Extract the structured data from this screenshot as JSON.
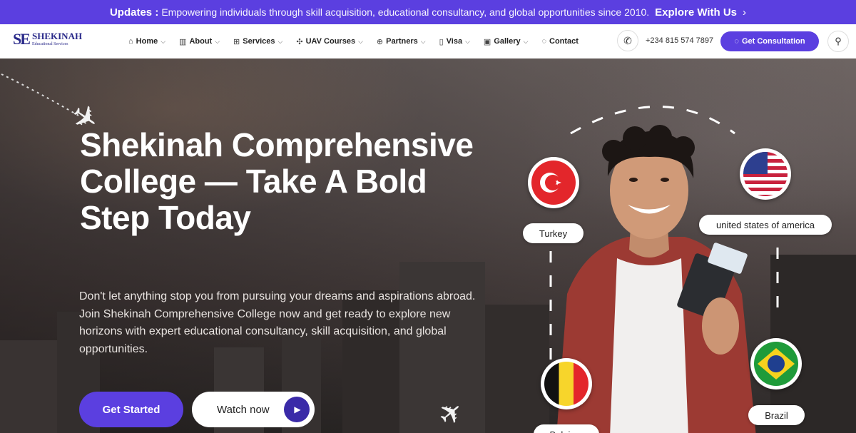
{
  "topbar": {
    "label": "Updates :",
    "message": "Empowering individuals through skill acquisition, educational consultancy, and global opportunities since 2010.",
    "cta": "Explore With Us"
  },
  "logo": {
    "mark": "SE",
    "name": "SHEKINAH",
    "sub": "Educational Services"
  },
  "nav": [
    {
      "label": "Home",
      "icon": "home-icon",
      "dropdown": true
    },
    {
      "label": "About",
      "icon": "chart-icon",
      "dropdown": true
    },
    {
      "label": "Services",
      "icon": "grid-icon",
      "dropdown": true
    },
    {
      "label": "UAV Courses",
      "icon": "drone-icon",
      "dropdown": true
    },
    {
      "label": "Partners",
      "icon": "globe-icon",
      "dropdown": true
    },
    {
      "label": "Visa",
      "icon": "document-icon",
      "dropdown": true
    },
    {
      "label": "Gallery",
      "icon": "image-icon",
      "dropdown": true
    },
    {
      "label": "Contact",
      "icon": "chat-icon",
      "dropdown": false
    }
  ],
  "phone": "+234 815 574 7897",
  "consult_label": "Get Consultation",
  "hero": {
    "title": "Shekinah Comprehensive College — Take A Bold Step Today",
    "description": "Don't let anything stop you from pursuing your dreams and aspirations abroad. Join Shekinah Comprehensive College now and get ready to explore new horizons with expert educational consultancy, skill acquisition, and global opportunities.",
    "start_label": "Get Started",
    "watch_label": "Watch now"
  },
  "countries": {
    "turkey": "Turkey",
    "usa": "united states of america",
    "brazil": "Brazil",
    "belgium": "Belgium"
  },
  "colors": {
    "brand": "#5b3fe0",
    "play": "#3a2aa8"
  }
}
